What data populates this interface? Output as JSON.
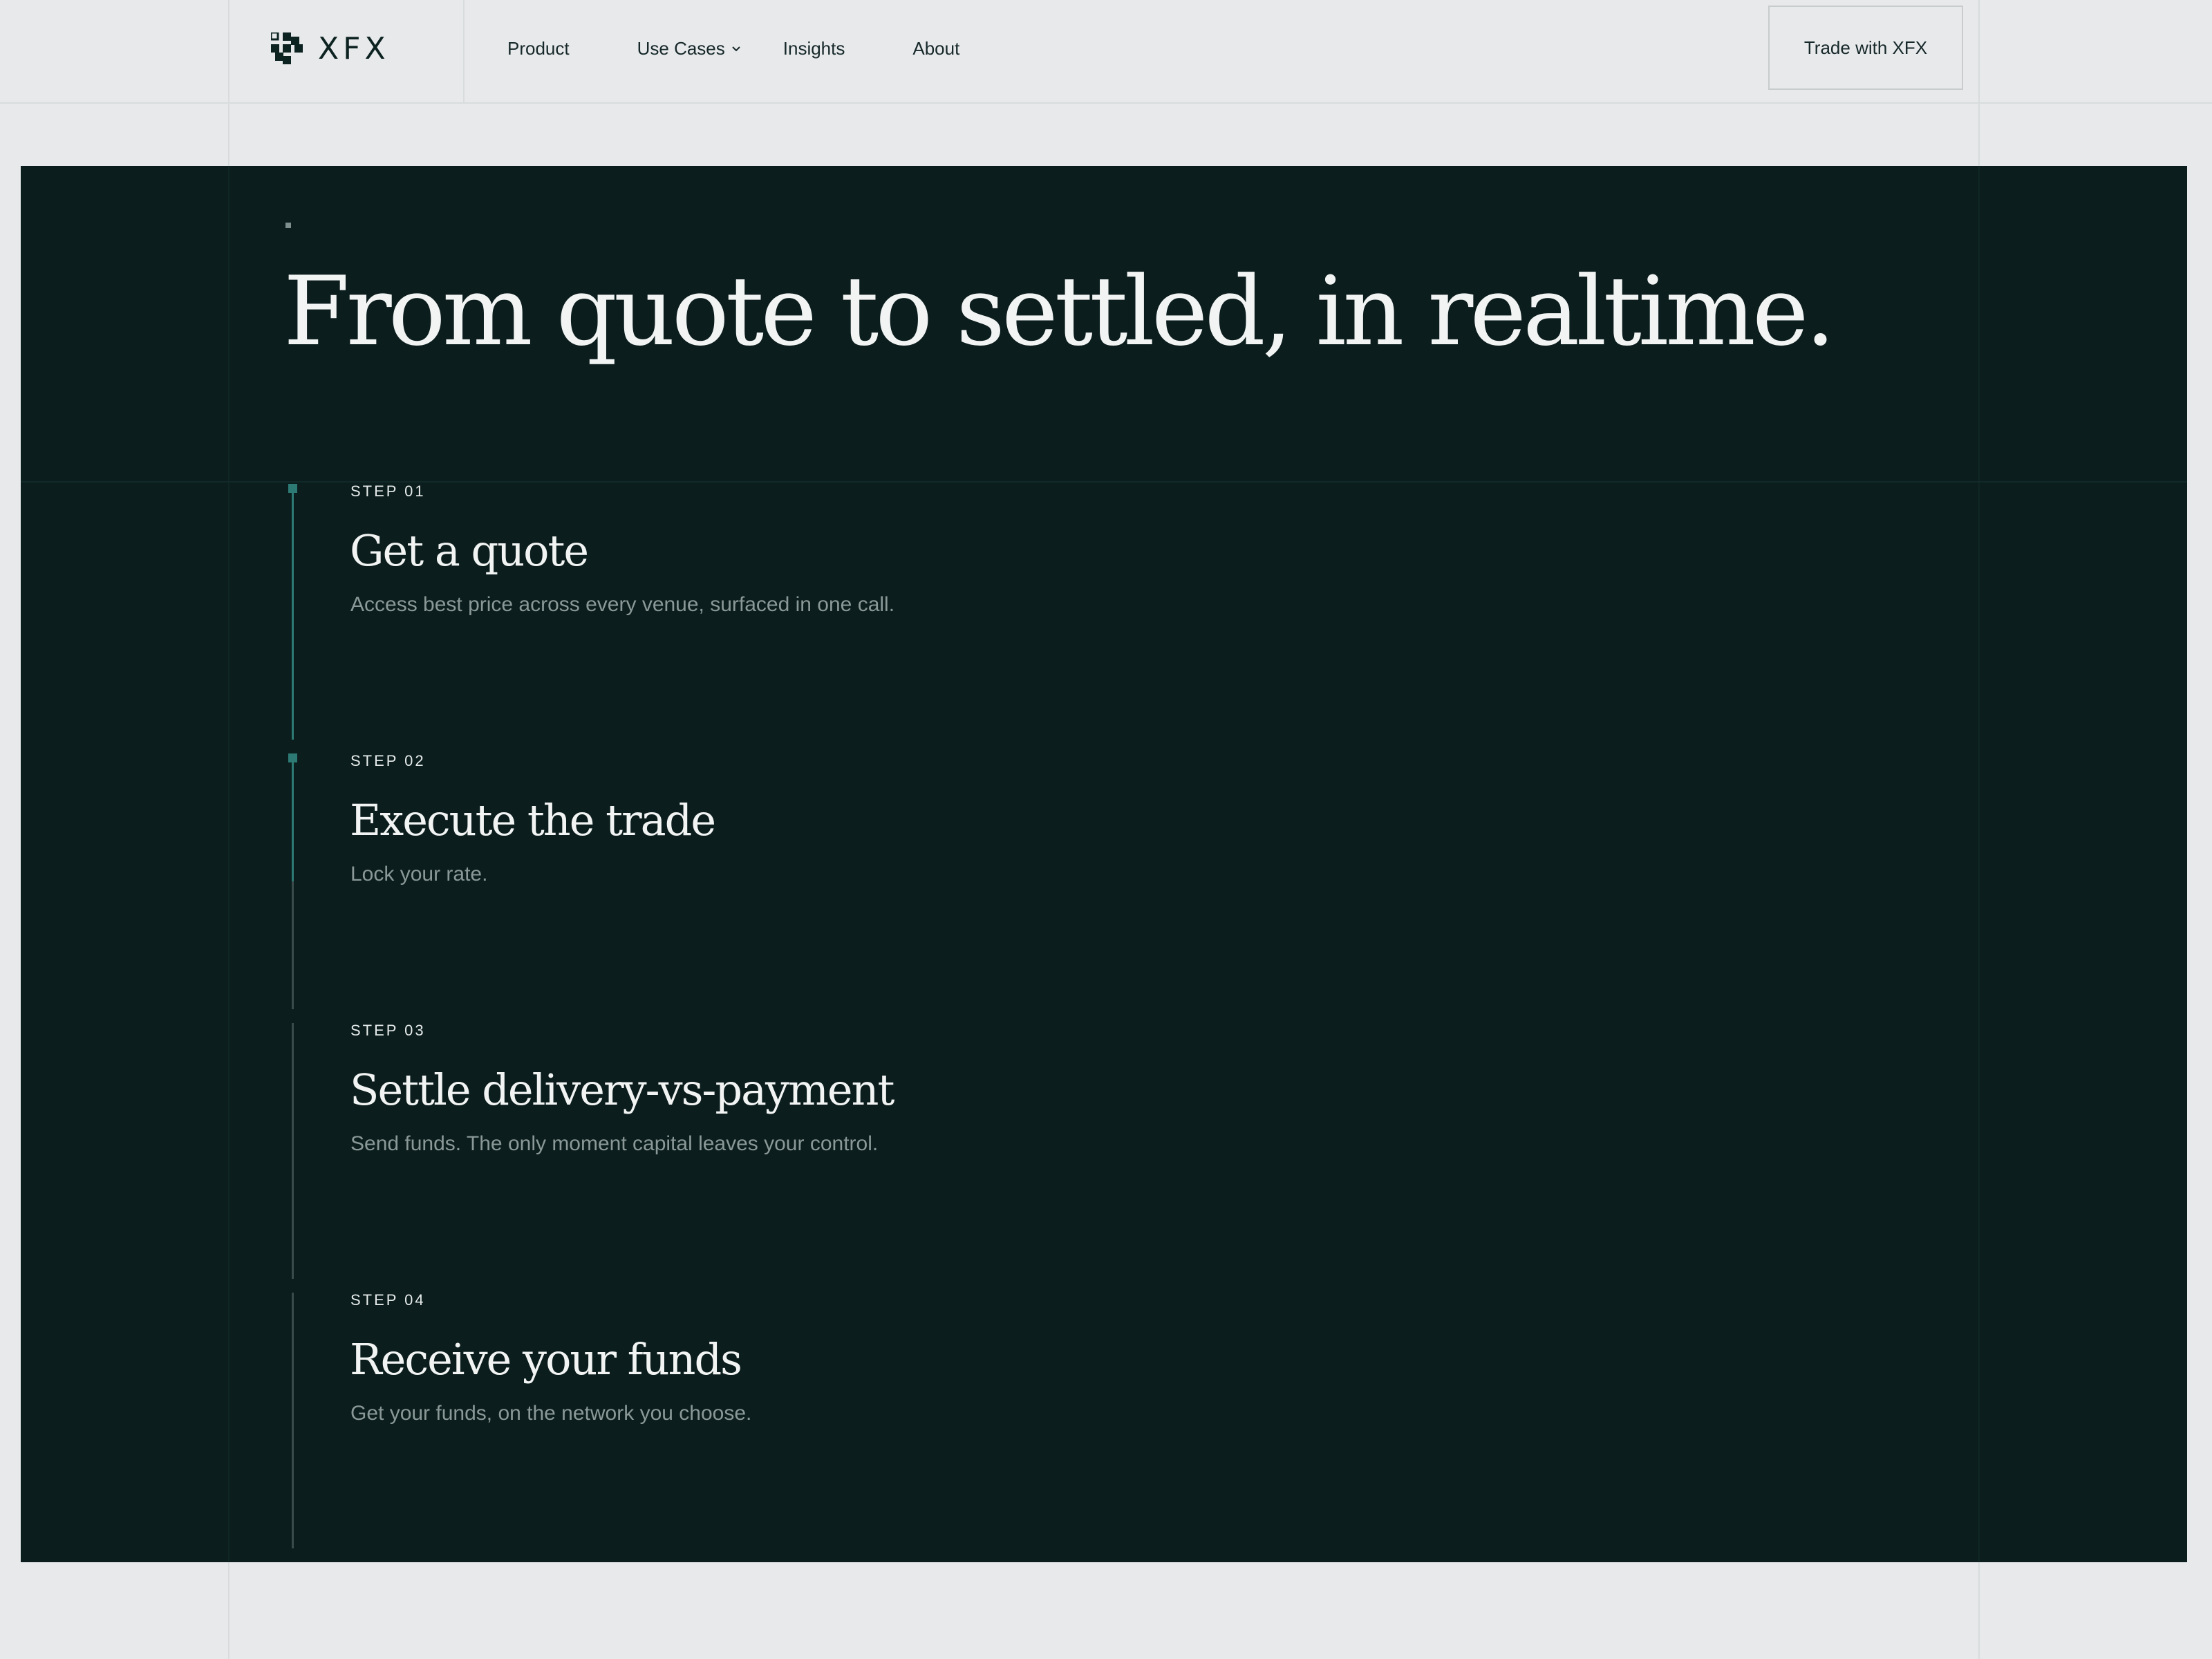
{
  "brand": {
    "name": "XFX",
    "logo_icon": "xfx-logo-mark-icon"
  },
  "nav": {
    "items": [
      {
        "label": "Product"
      },
      {
        "label": "Use Cases",
        "icon": "chevron-down-icon"
      },
      {
        "label": "Insights"
      },
      {
        "label": "About"
      }
    ],
    "cta_label": "Trade with XFX"
  },
  "hero": {
    "headline": "From quote to settled, in realtime."
  },
  "steps": [
    {
      "label": "STEP 01",
      "title": "Get a quote",
      "description": "Access best price across every venue, surfaced in one call.",
      "active": true
    },
    {
      "label": "STEP 02",
      "title": "Execute the trade",
      "description": "Lock your rate.",
      "active": true,
      "progress": 0.5
    },
    {
      "label": "STEP 03",
      "title": "Settle delivery-vs-payment",
      "description": "Send funds. The only moment capital leaves your control.",
      "active": false
    },
    {
      "label": "STEP 04",
      "title": "Receive your funds",
      "description": "Get your funds, on the network you choose.",
      "active": false
    }
  ],
  "colors": {
    "page_bg": "#e8e9ea",
    "panel_bg": "#0b1d1d",
    "accent": "#2d7a74",
    "text_dark": "#16282a",
    "text_light": "#f2f4f3",
    "text_muted": "#8a9997"
  }
}
